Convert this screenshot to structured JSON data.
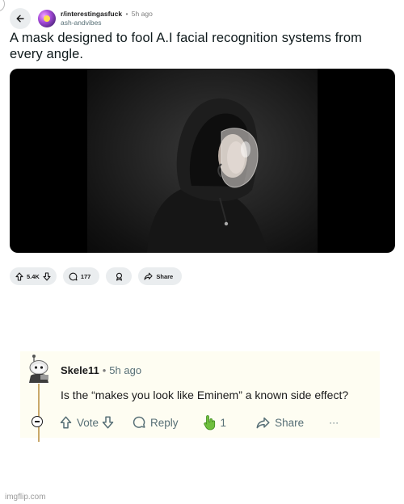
{
  "post": {
    "subreddit": "r/interestingasfuck",
    "separator": "•",
    "time": "5h ago",
    "author": "ash-andvibes",
    "title": "A mask designed to fool A.I facial recognition systems from every angle.",
    "image_alt": "Person in black hoodie wearing transparent face mask",
    "upvotes": "5.4K",
    "comments": "177",
    "share_label": "Share"
  },
  "comment": {
    "username": "Skele11",
    "separator": "•",
    "time": "5h ago",
    "text": "Is the “makes you look like Eminem” a known side effect?",
    "vote_label": "Vote",
    "reply_label": "Reply",
    "award_count": "1",
    "share_label": "Share",
    "more_label": "···"
  },
  "watermark": "imgflip.com"
}
